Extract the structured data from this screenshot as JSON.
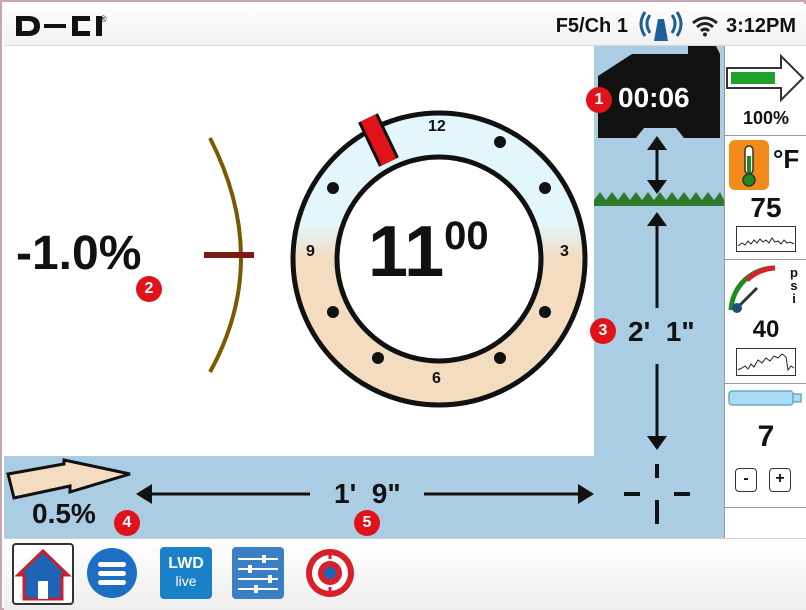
{
  "header": {
    "brand": "DCI",
    "channel": "F5/Ch 1",
    "time": "3:12PM"
  },
  "display": {
    "roll_hour": "11",
    "roll_minutes": "00",
    "clock_labels": [
      "12",
      "3",
      "6",
      "9"
    ],
    "pitch": "-1.0%",
    "locator_pitch": "0.5%",
    "update_timer": "00:06",
    "depth": "2'  1\"",
    "horizontal_distance": "1'  9\""
  },
  "callouts": [
    "1",
    "2",
    "3",
    "4",
    "5"
  ],
  "side_panel": {
    "battery_percent": "100%",
    "battery_level": 1.0,
    "temp_unit": "°F",
    "temperature": "75",
    "pressure_unit_letters": [
      "p",
      "s",
      "i"
    ],
    "pressure": "40",
    "stepper_value": "7",
    "minus_label": "-",
    "plus_label": "+"
  },
  "nav": [
    "home-icon",
    "menu-icon",
    "lwd-live-icon",
    "settings-sliders-icon",
    "target-icon"
  ],
  "lwd_icon_text": {
    "top": "LWD",
    "bottom": "live"
  },
  "colors": {
    "sky": "#e3f6fb",
    "ground": "#f3dcbf",
    "panel_blue": "#aacde3",
    "alert_red": "#e0131b",
    "grass": "#2d7a2d",
    "arc": "#7a5a00"
  }
}
